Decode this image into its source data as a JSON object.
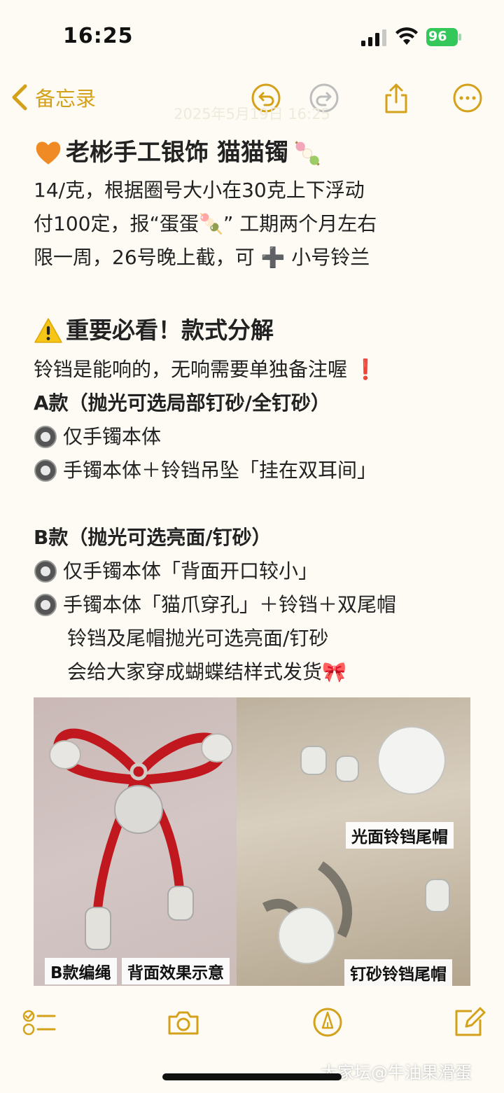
{
  "status": {
    "time": "16:25",
    "battery": "96"
  },
  "nav": {
    "back_label": "备忘录",
    "timestamp": "2025年5月19日 16:25"
  },
  "note": {
    "title": "老彬手工银饰 猫猫镯",
    "line1": "14/克，根据圈号大小在30克上下浮动",
    "line2": "付100定，报“蛋蛋🍡” 工期两个月左右",
    "line3": "限一周，26号晚上截，可 ➕ 小号铃兰",
    "heading": "重要必看！款式分解",
    "line4": "铃铛是能响的，无响需要单独备注喔 ❗",
    "a_title": "A款（抛光可选局部钉砂/全钉砂）",
    "a_opt1": "仅手镯本体",
    "a_opt2": "手镯本体＋铃铛吊坠「挂在双耳间」",
    "b_title": "B款（抛光可选亮面/钉砂）",
    "b_opt1": "仅手镯本体「背面开口较小」",
    "b_opt2": "手镯本体「猫爪穿孔」＋铃铛＋双尾帽",
    "b_sub1": "铃铛及尾帽抛光可选亮面/钉砂",
    "b_sub2": "会给大家穿成蝴蝶结样式发货🎀"
  },
  "photo": {
    "label_shiny": "光面铃铛尾帽",
    "label_braid": "B款编绳",
    "label_back": "背面效果示意",
    "label_matte": "钉砂铃铛尾帽"
  },
  "watermark": "大家坛@牛油果滑蛋",
  "colors": {
    "accent": "#d4a21a",
    "background": "#fdfbf3"
  }
}
